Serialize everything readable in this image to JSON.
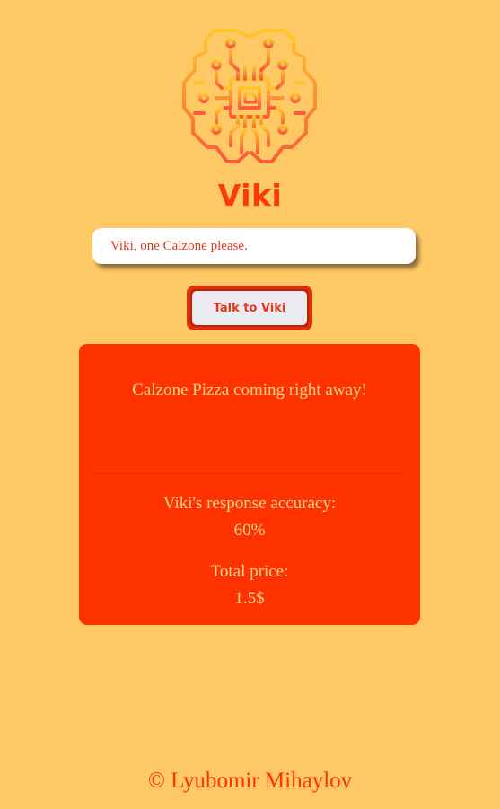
{
  "app": {
    "title": "Viki",
    "logo_icon": "brain-circuit-icon"
  },
  "query": {
    "value": "Viki, one Calzone please."
  },
  "talk_button": {
    "label": "Talk to Viki"
  },
  "response": {
    "message": "Calzone Pizza coming right away!",
    "accuracy_label": "Viki's response accuracy:",
    "accuracy_value": "60%",
    "price_label": "Total price:",
    "price_value": "1.5$"
  },
  "footer": {
    "copyright": "© Lyubomir Mihaylov"
  },
  "colors": {
    "background": "#FFC966",
    "accent": "#FF3300",
    "panel_text": "#FFD58A",
    "logo_gradient_top": "#FFC72C",
    "logo_gradient_bottom": "#FF5A3C"
  }
}
